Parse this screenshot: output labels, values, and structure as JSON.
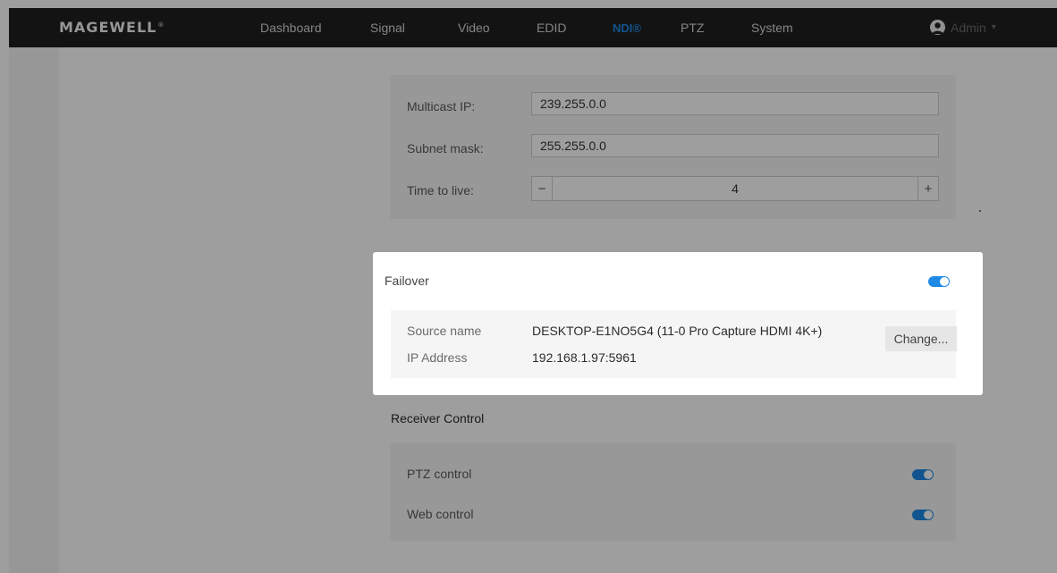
{
  "nav": {
    "logo": "MAGEWELL",
    "logo_mark": "®",
    "items": [
      "Dashboard",
      "Signal",
      "Video",
      "EDID",
      "NDI®",
      "PTZ",
      "System"
    ],
    "active": "NDI®",
    "user": "Admin"
  },
  "multicast": {
    "ip_label": "Multicast IP:",
    "ip_value": "239.255.0.0",
    "mask_label": "Subnet mask:",
    "mask_value": "255.255.0.0",
    "ttl_label": "Time to live:",
    "ttl_value": "4",
    "minus": "−",
    "plus": "+"
  },
  "failover": {
    "title": "Failover",
    "enabled": true,
    "source_label": "Source name",
    "source_value": "DESKTOP-E1NO5G4 (11-0 Pro Capture HDMI 4K+)",
    "ip_label": "IP Address",
    "ip_value": "192.168.1.97:5961",
    "change_label": "Change..."
  },
  "receiver": {
    "title": "Receiver Control",
    "ptz_label": "PTZ control",
    "ptz_enabled": true,
    "web_label": "Web control",
    "web_enabled": true
  },
  "colors": {
    "accent": "#1e88e5",
    "nav_bg": "#1f1f1f"
  }
}
